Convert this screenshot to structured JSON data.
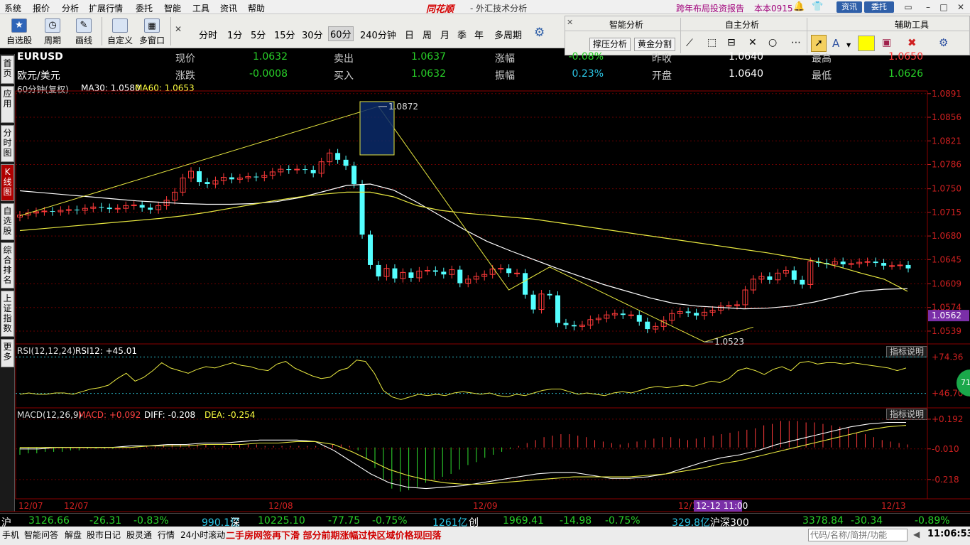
{
  "menu": {
    "items": [
      "系统",
      "报价",
      "分析",
      "扩展行情",
      "委托",
      "智能",
      "工具",
      "资讯",
      "帮助"
    ],
    "brand": "同花顺",
    "subtitle": "- 外汇技术分析",
    "promo": "跨年布局投资报告",
    "account": "本本0915",
    "btn_news": "资讯",
    "btn_trade": "委托"
  },
  "toolbar": {
    "tools": [
      "自选股",
      "周期",
      "画线",
      "自定义",
      "多窗口"
    ],
    "periods": [
      "分时",
      "1分",
      "5分",
      "15分",
      "30分",
      "60分",
      "240分钟",
      "日",
      "周",
      "月",
      "季",
      "年",
      "多周期"
    ],
    "active_period": "60分",
    "panel_smart": "智能分析",
    "panel_self": "自主分析",
    "panel_aux": "辅助工具",
    "btn_pressure": "撑压分析",
    "btn_golden": "黄金分割"
  },
  "left_tabs": [
    "首页",
    "应用",
    "分时图",
    "K线图",
    "自选股",
    "综合排名",
    "上证指数",
    "更多"
  ],
  "quote": {
    "symbol": "EURUSD",
    "name": "欧元/美元",
    "row1": [
      {
        "label": "现价",
        "value": "1.0632"
      },
      {
        "label": "卖出",
        "value": "1.0637"
      },
      {
        "label": "涨幅",
        "value": "-0.08%"
      },
      {
        "label": "昨收",
        "value": "1.0640"
      },
      {
        "label": "最高",
        "value": "1.0650"
      }
    ],
    "row2": [
      {
        "label": "涨跌",
        "value": "-0.0008"
      },
      {
        "label": "买入",
        "value": "1.0632"
      },
      {
        "label": "振幅",
        "value": "0.23%"
      },
      {
        "label": "开盘",
        "value": "1.0640"
      },
      {
        "label": "最低",
        "value": "1.0626"
      }
    ]
  },
  "indicators": {
    "ma_prefix": "60分钟(复权)",
    "ma30_label": "MA30: 1.0580",
    "ma60_label": "MA60: 1.0653",
    "rsi_label": "RSI(12,12,24)",
    "rsi_value": "RSI12: +45.01",
    "macd_label": "MACD(12,26,9)",
    "macd_value": "MACD: +0.092",
    "diff_value": "DIFF: -0.208",
    "dea_value": "DEA: -0.254",
    "explain": "指标说明",
    "rsi_badge": "71"
  },
  "chart_data": {
    "type": "candlestick",
    "ylim": [
      1.052,
      1.0895
    ],
    "y_ticks": [
      "1.0891",
      "1.0856",
      "1.0821",
      "1.0786",
      "1.0750",
      "1.0715",
      "1.0680",
      "1.0645",
      "1.0609",
      "1.0574",
      "1.0539"
    ],
    "current_price_tag": "1.0562",
    "annot_high": "1.0872",
    "annot_low": "1.0523",
    "x_labels": [
      "12/07",
      "12/07",
      "12/08",
      "12/09",
      "12/1",
      "12/13"
    ],
    "cursor_time": "12-12 11:00",
    "closes": [
      1.0711,
      1.0714,
      1.0716,
      1.0717,
      1.0716,
      1.0718,
      1.0719,
      1.0718,
      1.0721,
      1.0723,
      1.0722,
      1.072,
      1.0721,
      1.0725,
      1.0726,
      1.0722,
      1.0719,
      1.0725,
      1.0733,
      1.0745,
      1.0766,
      1.0776,
      1.076,
      1.0757,
      1.0762,
      1.0767,
      1.0764,
      1.0766,
      1.0768,
      1.0767,
      1.077,
      1.0775,
      1.0779,
      1.0778,
      1.0779,
      1.0778,
      1.0773,
      1.079,
      1.0803,
      1.0793,
      1.0784,
      1.0757,
      1.0682,
      1.0637,
      1.062,
      1.0632,
      1.0617,
      1.0626,
      1.0618,
      1.0628,
      1.0629,
      1.0627,
      1.0623,
      1.063,
      1.061,
      1.0616,
      1.062,
      1.0623,
      1.0631,
      1.0632,
      1.0625,
      1.0625,
      1.0593,
      1.0571,
      1.0594,
      1.0592,
      1.0551,
      1.0548,
      1.0546,
      1.0548,
      1.0556,
      1.0558,
      1.0563,
      1.0565,
      1.0563,
      1.0563,
      1.0553,
      1.0542,
      1.0546,
      1.0555,
      1.0565,
      1.0568,
      1.0566,
      1.0562,
      1.0567,
      1.057,
      1.0576,
      1.0577,
      1.0578,
      1.06,
      1.0616,
      1.062,
      1.0615,
      1.0625,
      1.0629,
      1.0615,
      1.0608,
      1.0642,
      1.064,
      1.0638,
      1.0642,
      1.0638,
      1.0639,
      1.0641,
      1.0642,
      1.064,
      1.0636,
      1.0636,
      1.0637,
      1.0632
    ],
    "ma30": [
      1.0747,
      1.0744,
      1.0741,
      1.0738,
      1.0735,
      1.0732,
      1.073,
      1.0728,
      1.0727,
      1.0727,
      1.0728,
      1.0731,
      1.0737,
      1.0746,
      1.0755,
      1.0757,
      1.0748,
      1.073,
      1.071,
      1.069,
      1.0672,
      1.0658,
      1.0645,
      1.0632,
      1.062,
      1.0608,
      1.0598,
      1.0588,
      1.058,
      1.0576,
      1.0574,
      1.0572,
      1.0573,
      1.0576,
      1.0582,
      1.059,
      1.0598,
      1.0601,
      1.0602
    ],
    "ma60": [
      1.0688,
      1.0691,
      1.0694,
      1.0697,
      1.07,
      1.0703,
      1.0706,
      1.071,
      1.0715,
      1.0721,
      1.0727,
      1.0733,
      1.0738,
      1.0742,
      1.0745,
      1.0745,
      1.0738,
      1.0725,
      1.0718,
      1.0714,
      1.0711,
      1.0708,
      1.0705,
      1.07,
      1.0695,
      1.069,
      1.0685,
      1.068,
      1.0675,
      1.067,
      1.0665,
      1.066,
      1.0655,
      1.0649,
      1.0643,
      1.0635,
      1.0625,
      1.0616,
      1.0598
    ],
    "zigzag": [
      [
        1.071,
        0
      ],
      [
        1.0872,
        44
      ],
      [
        1.06,
        60
      ],
      [
        1.0634,
        65
      ],
      [
        1.0523,
        84
      ],
      [
        1.0545,
        90
      ]
    ],
    "rsi": {
      "ylim": [
        40,
        80
      ],
      "ticks": [
        "+74.36",
        "+46.70"
      ],
      "values": [
        46,
        47,
        46,
        46,
        47,
        47,
        46,
        48,
        50,
        51,
        53,
        58,
        62,
        56,
        59,
        64,
        70,
        66,
        64,
        62,
        65,
        67,
        66,
        68,
        70,
        68,
        67,
        65,
        64,
        69,
        71,
        66,
        63,
        60,
        58,
        59,
        64,
        66,
        72,
        71,
        62,
        49,
        44,
        42,
        44,
        46,
        45,
        46,
        45,
        47,
        48,
        47,
        46,
        47,
        45,
        44,
        46,
        45,
        47,
        49,
        50,
        50,
        48,
        46,
        47,
        46,
        45,
        47,
        48,
        47,
        49,
        51,
        52,
        51,
        52,
        53,
        52,
        54,
        56,
        55,
        58,
        64,
        66,
        64,
        61,
        65,
        67,
        64,
        70,
        71,
        69,
        70,
        70,
        69,
        70,
        69,
        68,
        67,
        66,
        64,
        66
      ]
    },
    "macd": {
      "ylim": [
        -0.33,
        0.24
      ],
      "ticks": [
        "+0.192",
        "-0.010",
        "-0.218"
      ],
      "hist": [
        -0.05,
        -0.04,
        -0.04,
        -0.03,
        -0.03,
        -0.03,
        -0.02,
        -0.02,
        -0.01,
        -0.01,
        -0.01,
        -0.01,
        0,
        0,
        0,
        0.01,
        0.01,
        0.02,
        0.02,
        0.02,
        0.02,
        0.02,
        0.02,
        0.01,
        0.01,
        0.02,
        0.02,
        0.02,
        0.02,
        0.01,
        0.01,
        0.01,
        0.01,
        0.01,
        0.01,
        0.01,
        0.01,
        0.02,
        0.02,
        0.01,
        -0.02,
        -0.08,
        -0.14,
        -0.22,
        -0.28,
        -0.3,
        -0.29,
        -0.27,
        -0.24,
        -0.22,
        -0.2,
        -0.18,
        -0.15,
        -0.12,
        -0.1,
        -0.07,
        -0.05,
        -0.03,
        -0.01,
        0.01,
        0.03,
        0.05,
        0.07,
        0.08,
        0.09,
        0.09,
        0.08,
        0.07,
        0.05,
        0.04,
        0.03,
        0.02,
        0.03,
        0.04,
        0.05,
        0.06,
        0.07,
        0.07,
        0.06,
        0.05,
        0.06,
        0.07,
        0.08,
        0.09,
        0.1,
        0.11,
        0.12,
        0.13,
        0.15,
        0.16,
        0.18,
        0.18,
        0.18,
        0.17,
        0.17,
        0.16,
        0.15,
        0.14,
        0.13,
        0.1,
        0.09,
        0.07,
        0.05,
        0.04,
        0.03,
        0.02
      ],
      "diff": [
        -0.01,
        -0.01,
        0,
        0,
        0,
        0,
        0.01,
        0.01,
        0.02,
        0.02,
        0.03,
        0.03,
        0.04,
        0.05,
        0.05,
        0.05,
        0.04,
        -0.02,
        -0.1,
        -0.18,
        -0.24,
        -0.27,
        -0.28,
        -0.27,
        -0.26,
        -0.24,
        -0.22,
        -0.2,
        -0.18,
        -0.17,
        -0.17,
        -0.19,
        -0.21,
        -0.21,
        -0.2,
        -0.18,
        -0.14,
        -0.1,
        -0.07,
        -0.05,
        -0.02,
        0.02,
        0.05,
        0.08,
        0.11,
        0.14,
        0.16,
        0.17,
        0.17
      ],
      "dea": [
        0,
        0,
        0,
        0,
        0,
        0,
        0,
        0.01,
        0.01,
        0.01,
        0.02,
        0.02,
        0.02,
        0.03,
        0.03,
        0.04,
        0.04,
        0.02,
        -0.03,
        -0.09,
        -0.15,
        -0.19,
        -0.22,
        -0.24,
        -0.25,
        -0.25,
        -0.24,
        -0.23,
        -0.22,
        -0.21,
        -0.2,
        -0.2,
        -0.2,
        -0.2,
        -0.19,
        -0.18,
        -0.16,
        -0.14,
        -0.11,
        -0.09,
        -0.06,
        -0.03,
        0,
        0.03,
        0.06,
        0.09,
        0.12,
        0.14,
        0.15
      ]
    }
  },
  "status": {
    "sh": "沪",
    "sh_val": "3126.66",
    "sh_chg": "-26.31",
    "sh_pct": "-0.83%",
    "sh_amt": "990.1亿",
    "sz": "深",
    "sz_val": "10225.10",
    "sz_chg": "-77.75",
    "sz_pct": "-0.75%",
    "sz_amt": "1261亿",
    "cy": "创",
    "cy_val": "1969.41",
    "cy_chg": "-14.98",
    "cy_pct": "-0.75%",
    "cy_amt": "329.8亿",
    "hs": "沪深300",
    "hs_val": "3378.84",
    "hs_chg": "-30.34",
    "hs_pct": "-0.89%"
  },
  "bottom": {
    "items": [
      "手机",
      "智能问答",
      "解盘",
      "股市日记",
      "股灵通",
      "行情",
      "24小时滚动"
    ],
    "ticker": "二手房网签再下滑 部分前期涨幅过快区域价格现回落",
    "search_placeholder": "代码/名称/简拼/功能",
    "clock": "11:06:53"
  }
}
